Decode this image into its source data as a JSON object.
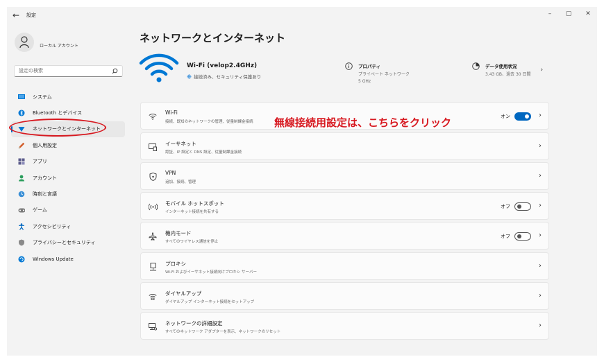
{
  "window": {
    "title": "設定",
    "back_glyph": "←",
    "minimize_glyph": "–",
    "maximize_glyph": "▢",
    "close_glyph": "✕"
  },
  "account": {
    "name": "ローカル アカウント"
  },
  "search": {
    "placeholder": "設定の検索"
  },
  "sidebar": {
    "items": [
      {
        "label": "システム",
        "icon": "system-icon",
        "color": "#0078d4"
      },
      {
        "label": "Bluetooth とデバイス",
        "icon": "bluetooth-icon",
        "color": "#0078d4"
      },
      {
        "label": "ネットワークとインターネット",
        "icon": "network-icon",
        "color": "#0078d4",
        "selected": true
      },
      {
        "label": "個人用設定",
        "icon": "personalization-icon",
        "color": "#d15b27"
      },
      {
        "label": "アプリ",
        "icon": "apps-icon",
        "color": "#5a5a8a"
      },
      {
        "label": "アカウント",
        "icon": "accounts-icon",
        "color": "#2a9d5c"
      },
      {
        "label": "時刻と言語",
        "icon": "time-language-icon",
        "color": "#0078d4"
      },
      {
        "label": "ゲーム",
        "icon": "gaming-icon",
        "color": "#777777"
      },
      {
        "label": "アクセシビリティ",
        "icon": "accessibility-icon",
        "color": "#0067c0"
      },
      {
        "label": "プライバシーとセキュリティ",
        "icon": "privacy-icon",
        "color": "#777777"
      },
      {
        "label": "Windows Update",
        "icon": "windows-update-icon",
        "color": "#0078d4"
      }
    ]
  },
  "main": {
    "title": "ネットワークとインターネット",
    "hero": {
      "network_name": "Wi-Fi (velop2.4GHz)",
      "status": "接続済み、セキュリティ保護あり",
      "properties": {
        "title": "プロパティ",
        "line1": "プライベート ネットワーク",
        "line2": "5 GHz"
      },
      "usage": {
        "title": "データ使用状況",
        "line1": "3.43 GB、過去 30 日間"
      }
    },
    "annotation": "無線接続用設定は、こちらをクリック",
    "cards": [
      {
        "title": "Wi-Fi",
        "subtitle": "接続、既知のネットワークの管理、従量制課金接続",
        "icon": "wifi-icon",
        "toggle_label": "オン",
        "toggle": "on"
      },
      {
        "title": "イーサネット",
        "subtitle": "認証、IP 設定と DNS 設定、従量制課金接続",
        "icon": "ethernet-icon"
      },
      {
        "title": "VPN",
        "subtitle": "追加、接続、管理",
        "icon": "vpn-icon"
      },
      {
        "title": "モバイル ホットスポット",
        "subtitle": "インターネット接続を共有する",
        "icon": "hotspot-icon",
        "toggle_label": "オフ",
        "toggle": "off"
      },
      {
        "title": "機内モード",
        "subtitle": "すべてのワイヤレス通信を停止",
        "icon": "airplane-icon",
        "toggle_label": "オフ",
        "toggle": "off"
      },
      {
        "title": "プロキシ",
        "subtitle": "Wi-Fi およびイーサネット接続向けプロキシ サーバー",
        "icon": "proxy-icon"
      },
      {
        "title": "ダイヤルアップ",
        "subtitle": "ダイヤルアップ インターネット接続をセットアップ",
        "icon": "dialup-icon"
      },
      {
        "title": "ネットワークの詳細設定",
        "subtitle": "すべてのネットワーク アダプターを表示、ネットワークのリセット",
        "icon": "advanced-network-icon"
      }
    ],
    "chevron": "›"
  },
  "colors": {
    "accent": "#0067c0",
    "annotation": "#d71920",
    "wifi_hero": "#0078d4"
  }
}
